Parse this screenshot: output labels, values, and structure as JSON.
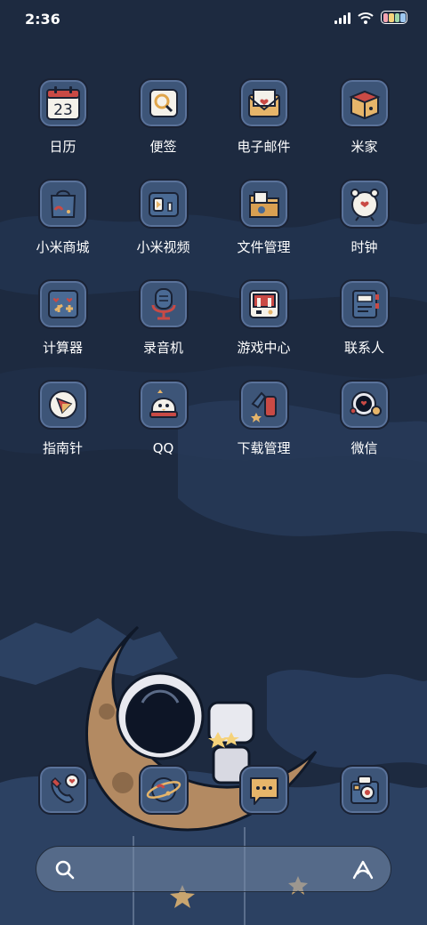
{
  "status": {
    "time": "2:36",
    "icons": [
      "signal-icon",
      "wifi-icon",
      "battery-icon"
    ],
    "battery_colors": [
      "#f4a3b0",
      "#f5d27a",
      "#9fd6a8",
      "#9ec8f0"
    ]
  },
  "apps": [
    {
      "label": "日历",
      "icon": "calendar-icon",
      "day": "23"
    },
    {
      "label": "便签",
      "icon": "notes-icon"
    },
    {
      "label": "电子邮件",
      "icon": "email-icon"
    },
    {
      "label": "米家",
      "icon": "mijia-icon"
    },
    {
      "label": "小米商城",
      "icon": "shop-icon"
    },
    {
      "label": "小米视频",
      "icon": "video-icon"
    },
    {
      "label": "文件管理",
      "icon": "folder-icon"
    },
    {
      "label": "时钟",
      "icon": "clock-icon"
    },
    {
      "label": "计算器",
      "icon": "calculator-icon"
    },
    {
      "label": "录音机",
      "icon": "recorder-icon"
    },
    {
      "label": "游戏中心",
      "icon": "game-icon"
    },
    {
      "label": "联系人",
      "icon": "contacts-icon"
    },
    {
      "label": "指南针",
      "icon": "compass-icon"
    },
    {
      "label": "QQ",
      "icon": "qq-icon"
    },
    {
      "label": "下载管理",
      "icon": "download-icon"
    },
    {
      "label": "微信",
      "icon": "wechat-icon"
    }
  ],
  "dock": [
    {
      "icon": "phone-icon"
    },
    {
      "icon": "browser-icon"
    },
    {
      "icon": "messages-icon"
    },
    {
      "icon": "camera-icon"
    }
  ],
  "search": {
    "icon": "search-icon",
    "assistant_icon": "assistant-icon"
  }
}
